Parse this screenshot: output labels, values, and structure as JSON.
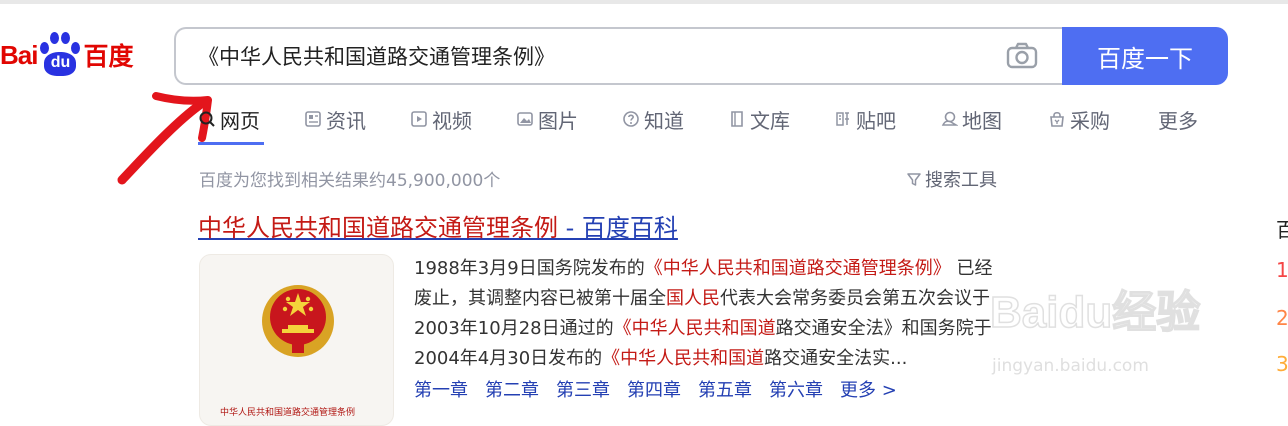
{
  "logo": {
    "bai": "Bai",
    "du": "du",
    "cn": "百度"
  },
  "search": {
    "query": "《中华人民共和国道路交通管理条例》",
    "button_label": "百度一下"
  },
  "tabs": [
    {
      "label": "网页",
      "icon": "search-icon",
      "active": true
    },
    {
      "label": "资讯",
      "icon": "news-icon"
    },
    {
      "label": "视频",
      "icon": "video-icon"
    },
    {
      "label": "图片",
      "icon": "image-icon"
    },
    {
      "label": "知道",
      "icon": "question-icon"
    },
    {
      "label": "文库",
      "icon": "document-icon"
    },
    {
      "label": "贴吧",
      "icon": "tieba-icon"
    },
    {
      "label": "地图",
      "icon": "map-pin-icon"
    },
    {
      "label": "采购",
      "icon": "shopping-icon"
    },
    {
      "label": "更多"
    }
  ],
  "results": {
    "stats": "百度为您找到相关结果约45,900,000个",
    "tools": "搜索工具"
  },
  "first_result": {
    "title_em": "中华人民共和国道路交通管理条例",
    "title_rest": " - 百度百科",
    "thumb_caption": "中华人民共和国道路交通管理条例",
    "abstract": {
      "l1a": "1988年3月9日国务院发布的",
      "l1b": "《中华人民共和国道路交通管理条例》",
      "l1c": " 已经",
      "l2a": "废止，其调整内容已被第十届全",
      "l2b": "国人民",
      "l2c": "代表大会常务委员会第五次会议于",
      "l3a": "2003年10月28日通过的",
      "l3b": "《中华人民共和国道",
      "l3c": "路交通安全法》和国务院于",
      "l4a": "2004年4月30日发布的",
      "l4b": "《中华人民共和国道",
      "l4c": "路交通安全法实..."
    },
    "chapters": [
      "第一章",
      "第二章",
      "第三章",
      "第四章",
      "第五章",
      "第六章",
      "更多 >"
    ]
  },
  "side": {
    "c0": "百",
    "c1": "1",
    "c2": "2",
    "c3": "3"
  },
  "watermark": {
    "text": "Baidu经验",
    "url": "jingyan.baidu.com"
  },
  "colors": {
    "accent": "#4e6ef2",
    "link": "#2440b3",
    "highlight": "#c41a15",
    "logo_red": "#e10602",
    "logo_blue": "#2932e1",
    "annotation_arrow": "#e3151c"
  }
}
